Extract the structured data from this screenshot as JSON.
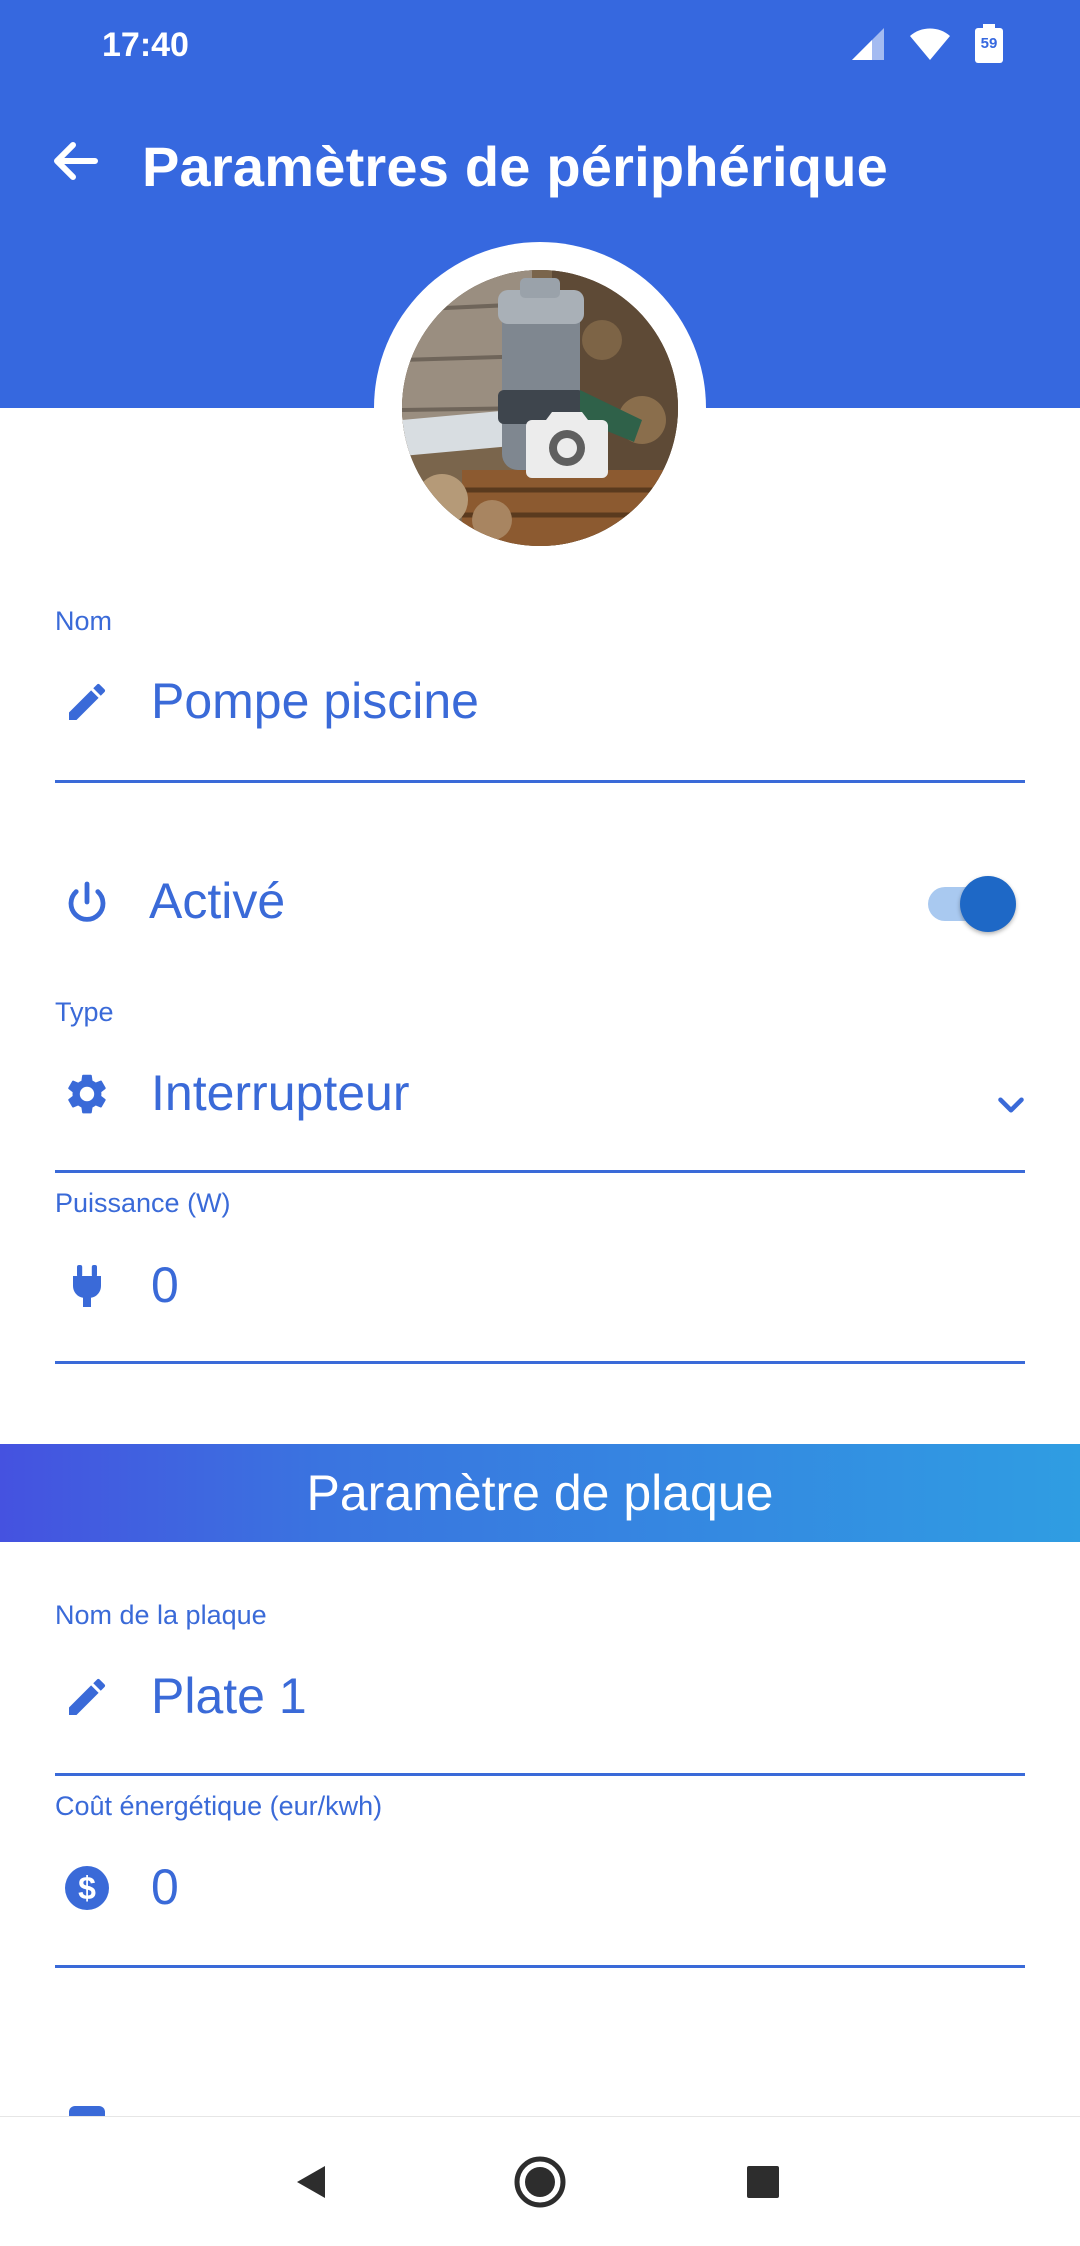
{
  "status_bar": {
    "time": "17:40",
    "battery_level": "59",
    "icons": [
      "signal-icon",
      "wifi-icon",
      "battery-icon"
    ]
  },
  "header": {
    "title": "Paramètres de périphérique",
    "back_icon": "arrow-back-icon"
  },
  "avatar": {
    "camera_icon": "camera-icon"
  },
  "fields": {
    "name": {
      "label": "Nom",
      "value": "Pompe piscine",
      "icon": "pencil-icon"
    },
    "active": {
      "label": "Activé",
      "icon": "power-icon",
      "enabled": true
    },
    "type": {
      "label": "Type",
      "value": "Interrupteur",
      "icon": "gear-icon"
    },
    "power": {
      "label": "Puissance (W)",
      "value": "0",
      "icon": "plug-icon"
    }
  },
  "plate_section": {
    "title": "Paramètre de plaque",
    "plate_name": {
      "label": "Nom de la plaque",
      "value": "Plate 1",
      "icon": "pencil-icon"
    },
    "energy_cost": {
      "label": "Coût énergétique (eur/kwh)",
      "value": "0",
      "icon": "dollar-circle-icon"
    }
  },
  "colors": {
    "primary": "#3668df",
    "accent_text": "#3a6ad8",
    "toggle_knob": "#1e68c6",
    "toggle_track": "#a9c9f0",
    "banner_start": "#4552e0",
    "banner_end": "#2f9de2"
  },
  "nav_bar": {
    "back": "nav-back-icon",
    "home": "nav-home-icon",
    "recents": "nav-recents-icon"
  }
}
